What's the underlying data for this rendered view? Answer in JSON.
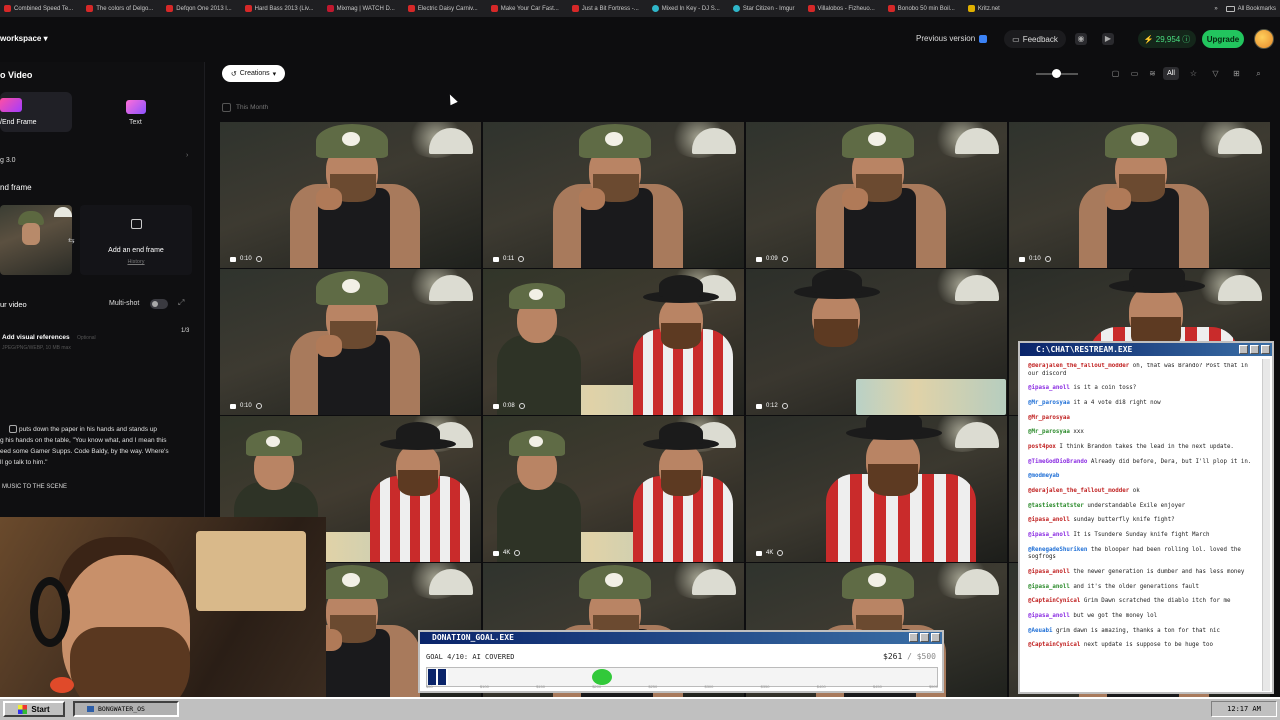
{
  "bookmarks": {
    "items": [
      {
        "label": "Combined Speed Te...",
        "icon": "youtube-icon"
      },
      {
        "label": "The colors of Delgo...",
        "icon": "youtube-icon"
      },
      {
        "label": "Defqon One 2013 l...",
        "icon": "youtube-icon"
      },
      {
        "label": "Hard Bass 2013 (Liv...",
        "icon": "youtube-icon"
      },
      {
        "label": "Mixmag | WATCH D...",
        "icon": "mixmag-icon"
      },
      {
        "label": "Electric Daisy Carniv...",
        "icon": "youtube-icon"
      },
      {
        "label": "Make Your Car Fast...",
        "icon": "youtube-icon"
      },
      {
        "label": "Just a Bit Fortress -...",
        "icon": "youtube-icon"
      },
      {
        "label": "Mixed In Key - DJ S...",
        "icon": "mixedinkey-icon"
      },
      {
        "label": "Star Citizen - Imgur",
        "icon": "imgur-icon"
      },
      {
        "label": "Villalobos - Fizheuo...",
        "icon": "youtube-icon"
      },
      {
        "label": "Bonobo 50 min Boil...",
        "icon": "youtube-icon"
      },
      {
        "label": "Kritz.net",
        "icon": "kritz-icon"
      }
    ],
    "more": "»",
    "all_bookmarks": "All Bookmarks"
  },
  "header": {
    "workspace": "workspace",
    "previous_version": "Previous version",
    "feedback": "Feedback",
    "credits": "29,954",
    "upgrade": "Upgrade"
  },
  "left_panel": {
    "title": "o Video",
    "modes": [
      {
        "label": "/End Frame"
      },
      {
        "label": "Text"
      }
    ],
    "model": "g 3.0",
    "end_frame_heading": "nd frame",
    "add_end_frame": "Add an end frame",
    "history": "History",
    "your_video": "ur video",
    "multishot": "Multi-shot",
    "visual_refs_label": "Add visual references",
    "visual_refs_optional": "Optional",
    "visual_refs_formats": "JPEG/PNG/WEBP, 10 MB max",
    "visual_refs_count": "1/3",
    "prompt_lines": [
      "puts down the paper in his hands and stands up",
      "g his hands on the table, \"You know what, and I mean this",
      "eed some Gamer Supps. Code Baldy, by the way. Where's",
      "ll go talk to him.\""
    ],
    "prompt_tail": "MUSIC TO THE SCENE"
  },
  "toolbar": {
    "creations": "Creations",
    "filter_all": "All",
    "this_month": "This Month"
  },
  "tiles": [
    {
      "duration": "0:10"
    },
    {
      "duration": "0:11"
    },
    {
      "duration": "0:09"
    },
    {
      "duration": "0:10"
    },
    {
      "duration": "0:10"
    },
    {
      "duration": "0:08"
    },
    {
      "duration": "0:12"
    },
    {
      "duration": ""
    },
    {
      "duration": ""
    },
    {
      "duration": "4K"
    },
    {
      "duration": "4K"
    },
    {
      "duration": ""
    }
  ],
  "chat": {
    "title": "C:\\CHAT\\RESTREAM.EXE",
    "messages": [
      {
        "user": "@derajalen_the_fallout_modder",
        "text": "oh, that was Brando? Post that in our discord"
      },
      {
        "user": "@ipasa_anoll",
        "text": "is it a coin toss?"
      },
      {
        "user": "@Mr_parosyaa",
        "text": "it a 4 vote di8 right now"
      },
      {
        "user": "@Mr_parosyaa",
        "text": ""
      },
      {
        "user": "@Mr_parosyaa",
        "text": "xxx"
      },
      {
        "user": "post4pox",
        "text": "I think Brandon takes the lead in the next update."
      },
      {
        "user": "@TimeGodDioBrando",
        "text": "Already did before, Dera, but I'll plop it in."
      },
      {
        "user": "@modmeyab",
        "text": ""
      },
      {
        "user": "@derajalen_the_fallout_modder",
        "text": "ok"
      },
      {
        "user": "@tastiesttatster",
        "text": "understandable Exile enjoyer"
      },
      {
        "user": "@ipasa_anoll",
        "text": "sunday butterfly knife fight?"
      },
      {
        "user": "@ipasa_anoll",
        "text": "It is Tsundere Sunday knife fight March"
      },
      {
        "user": "@RenegadeShuriken",
        "text": "the blooper had been rolling lol. loved the sogfrogs"
      },
      {
        "user": "@ipasa_anoll",
        "text": "the newer generation is dumber and has less money"
      },
      {
        "user": "@ipasa_anoll",
        "text": "and it's the older generations fault"
      },
      {
        "user": "@CaptainCynical",
        "text": "Grim Dawn scratched the diablo itch for me"
      },
      {
        "user": "@ipasa_anoll",
        "text": "but we got the money lol"
      },
      {
        "user": "@Aeuabi",
        "text": "grim dawn is amazing, thanks a ton for that nic"
      },
      {
        "user": "@CaptainCynical",
        "text": "next update is suppose to be huge too"
      }
    ]
  },
  "donation": {
    "title": "DONATION_GOAL.EXE",
    "goal_text": "GOAL 4/10: AI COVERED",
    "amount": "$261",
    "target": "/ $500",
    "progress": 0.04,
    "ticks": [
      "$50",
      "$100",
      "$150",
      "$200",
      "$250",
      "$300",
      "$350",
      "$400",
      "$450",
      "$500"
    ]
  },
  "taskbar": {
    "start": "Start",
    "task": "BONGWATER_OS",
    "clock": "12:17 AM"
  }
}
